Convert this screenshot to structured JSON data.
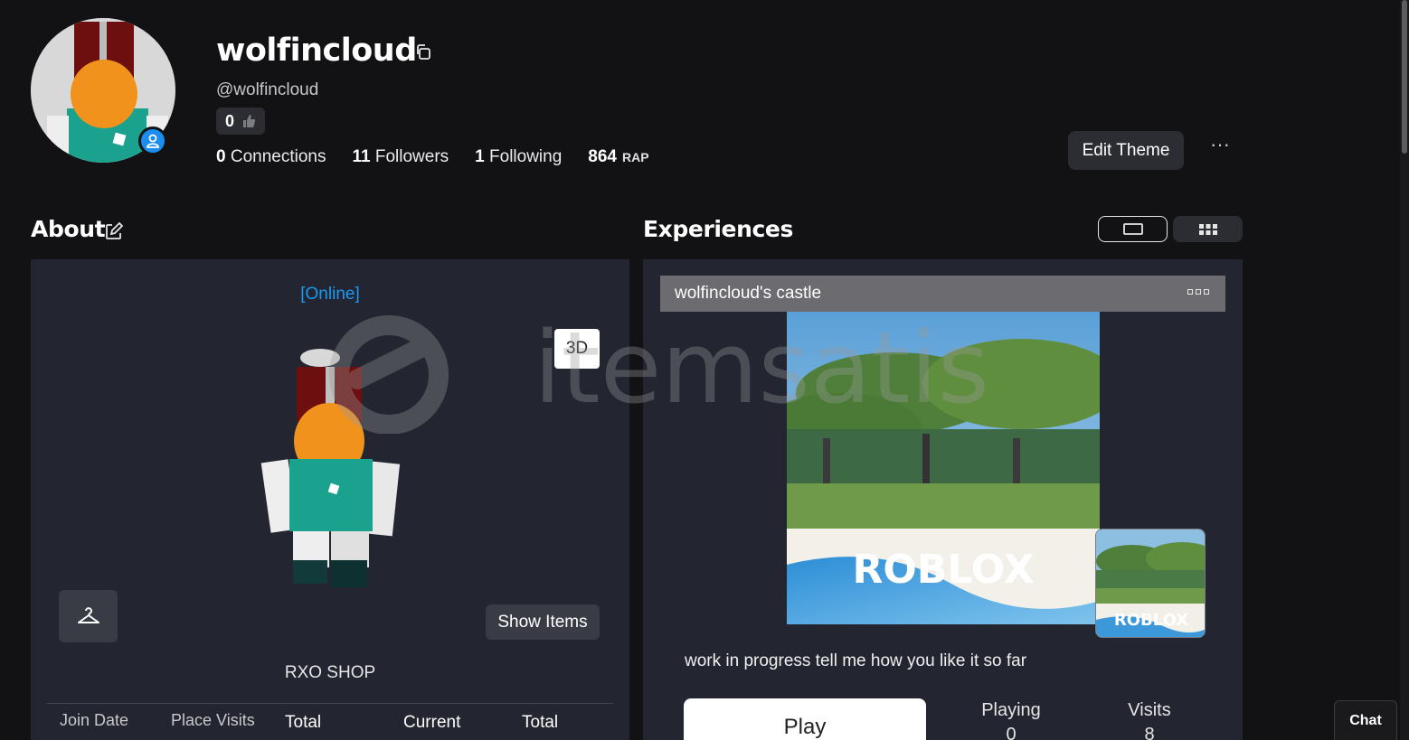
{
  "profile": {
    "display_name": "wolfincloud",
    "username": "@wolfincloud",
    "likes": "0",
    "stats": {
      "connections_count": "0",
      "connections_label": "Connections",
      "followers_count": "11",
      "followers_label": "Followers",
      "following_count": "1",
      "following_label": "Following",
      "rap_value": "864",
      "rap_label": "RAP"
    },
    "edit_theme_label": "Edit Theme",
    "more_label": "···"
  },
  "about": {
    "title": "About",
    "status": "[Online]",
    "view_3d_label": "3D",
    "show_items_label": "Show Items",
    "bio": "RXO SHOP",
    "columns": [
      "Join Date",
      "Place Visits",
      "Total",
      "Current",
      "Total"
    ]
  },
  "experiences": {
    "title": "Experiences",
    "game": {
      "name": "wolfincloud's castle",
      "logo_text": "ROBLOX",
      "description": "work in progress tell me how you like it so far",
      "play_label": "Play",
      "playing_label": "Playing",
      "playing_value": "0",
      "visits_label": "Visits",
      "visits_value": "8"
    }
  },
  "watermark": {
    "text": "itemsatis"
  },
  "chat": {
    "label": "Chat"
  },
  "colors": {
    "background": "#121215",
    "panel": "#232530",
    "accent_online": "#1a9af2",
    "presence": "#1b8cf0"
  }
}
